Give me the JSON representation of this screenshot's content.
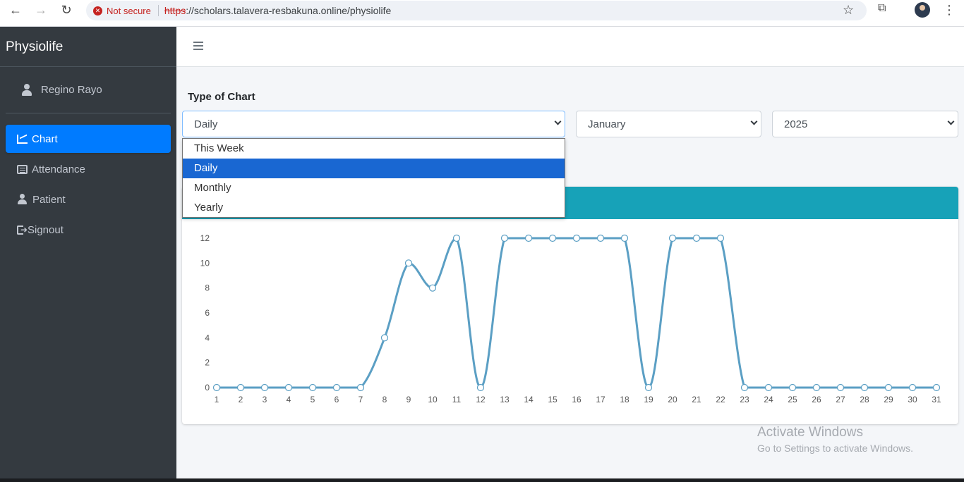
{
  "browser": {
    "security_label": "Not secure",
    "url_scheme": "https",
    "url_rest": "://scholars.talavera-resbakuna.online/physiolife"
  },
  "app": {
    "brand": "Physiolife"
  },
  "sidebar": {
    "user_name": "Regino Rayo",
    "items": [
      {
        "label": "Chart",
        "icon": "chart-line-icon",
        "active": true
      },
      {
        "label": "Attendance",
        "icon": "list-alt-icon",
        "active": false
      },
      {
        "label": "Patient",
        "icon": "user-icon",
        "active": false
      },
      {
        "label": "Signout",
        "icon": "sign-out-icon",
        "active": false
      }
    ]
  },
  "filters": {
    "title": "Type of Chart",
    "type_value": "Daily",
    "month_value": "January",
    "year_value": "2025",
    "type_options": [
      "This Week",
      "Daily",
      "Monthly",
      "Yearly"
    ],
    "type_selected": "Daily"
  },
  "colors": {
    "accent": "#007bff",
    "card_header": "#17a2b8",
    "line": "#5b9fc4",
    "sidebar": "#343a40"
  },
  "chart_data": {
    "type": "line",
    "x": [
      1,
      2,
      3,
      4,
      5,
      6,
      7,
      8,
      9,
      10,
      11,
      12,
      13,
      14,
      15,
      16,
      17,
      18,
      19,
      20,
      21,
      22,
      23,
      24,
      25,
      26,
      27,
      28,
      29,
      30,
      31
    ],
    "series": [
      {
        "values": [
          0,
          0,
          0,
          0,
          0,
          0,
          0,
          4,
          10,
          8,
          12,
          0,
          12,
          12,
          12,
          12,
          12,
          12,
          0,
          12,
          12,
          12,
          0,
          0,
          0,
          0,
          0,
          0,
          0,
          0,
          0
        ]
      }
    ],
    "ylim": [
      0,
      12
    ],
    "yticks": [
      0,
      2,
      4,
      6,
      8,
      10,
      12
    ],
    "grid": false
  },
  "watermark": {
    "title": "Activate Windows",
    "subtitle": "Go to Settings to activate Windows."
  }
}
